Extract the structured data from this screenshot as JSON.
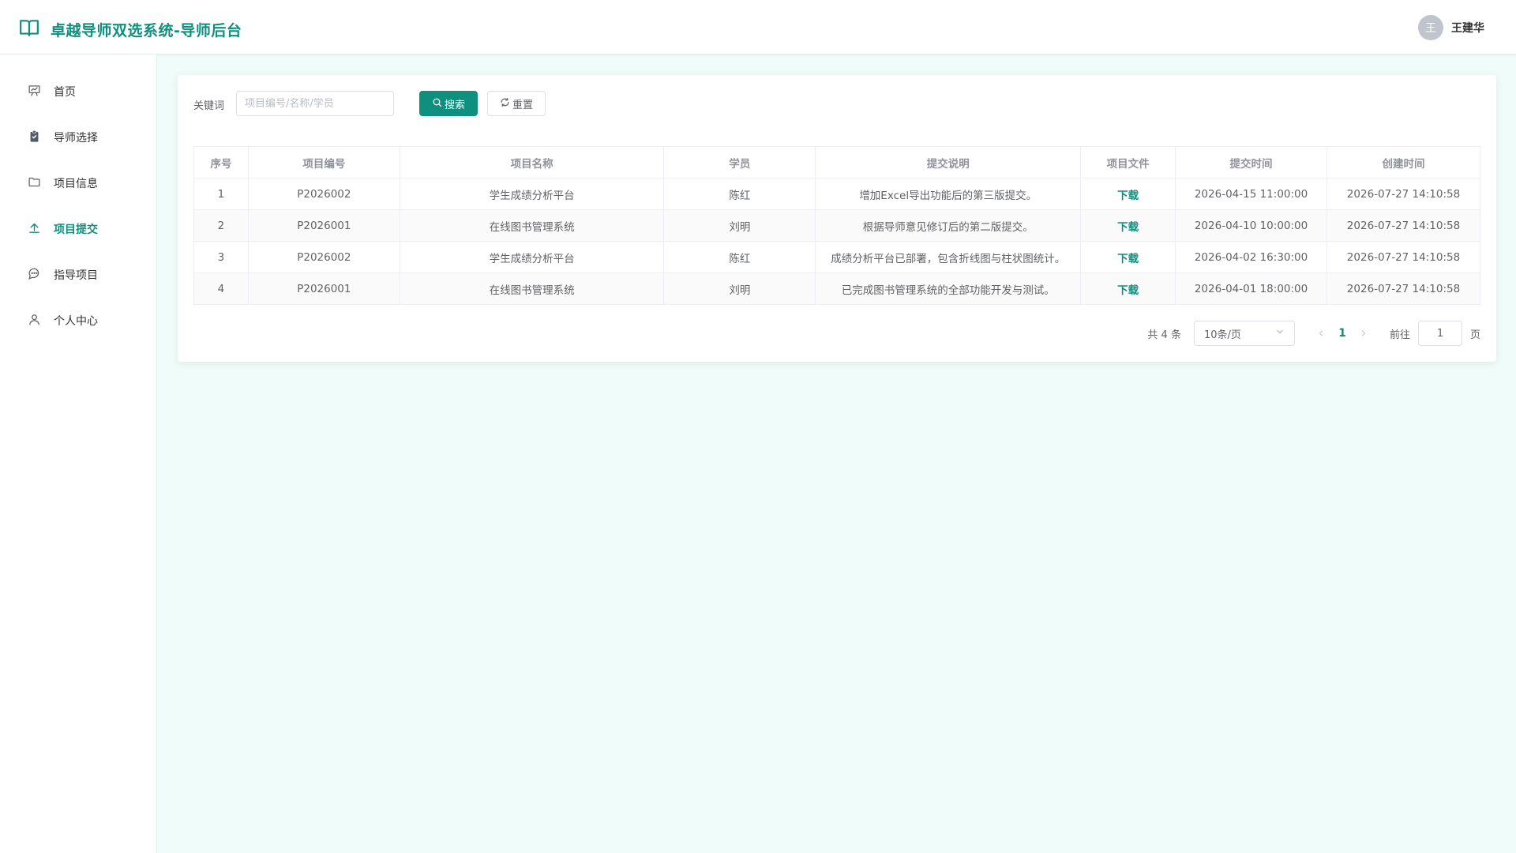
{
  "app": {
    "title": "卓越导师双选系统-导师后台",
    "user_avatar_char": "王",
    "user_name": "王建华",
    "accent_color": "#0f8f7e"
  },
  "sidebar": {
    "items": [
      {
        "label": "首页",
        "icon": "presentation-icon",
        "active": false
      },
      {
        "label": "导师选择",
        "icon": "clipboard-check-icon",
        "active": false
      },
      {
        "label": "项目信息",
        "icon": "folder-icon",
        "active": false
      },
      {
        "label": "项目提交",
        "icon": "upload-icon",
        "active": true
      },
      {
        "label": "指导项目",
        "icon": "chat-bubble-icon",
        "active": false
      },
      {
        "label": "个人中心",
        "icon": "user-icon",
        "active": false
      }
    ]
  },
  "search": {
    "label": "关键词",
    "placeholder": "项目编号/名称/学员",
    "value": "",
    "search_label": "搜索",
    "reset_label": "重置"
  },
  "table": {
    "columns": [
      "序号",
      "项目编号",
      "项目名称",
      "学员",
      "提交说明",
      "项目文件",
      "提交时间",
      "创建时间"
    ],
    "rows": [
      {
        "index": "1",
        "code": "P2026002",
        "name": "学生成绩分析平台",
        "student": "陈红",
        "note": "增加Excel导出功能后的第三版提交。",
        "file": "下载",
        "submit_time": "2026-04-15 11:00:00",
        "create_time": "2026-07-27 14:10:58"
      },
      {
        "index": "2",
        "code": "P2026001",
        "name": "在线图书管理系统",
        "student": "刘明",
        "note": "根据导师意见修订后的第二版提交。",
        "file": "下载",
        "submit_time": "2026-04-10 10:00:00",
        "create_time": "2026-07-27 14:10:58"
      },
      {
        "index": "3",
        "code": "P2026002",
        "name": "学生成绩分析平台",
        "student": "陈红",
        "note": "成绩分析平台已部署，包含折线图与柱状图统计。",
        "file": "下载",
        "submit_time": "2026-04-02 16:30:00",
        "create_time": "2026-07-27 14:10:58"
      },
      {
        "index": "4",
        "code": "P2026001",
        "name": "在线图书管理系统",
        "student": "刘明",
        "note": "已完成图书管理系统的全部功能开发与测试。",
        "file": "下载",
        "submit_time": "2026-04-01 18:00:00",
        "create_time": "2026-07-27 14:10:58"
      }
    ]
  },
  "pagination": {
    "total_text": "共 4 条",
    "page_size": "10条/页",
    "current_page": "1",
    "goto_label": "前往",
    "goto_value": "1",
    "page_unit": "页"
  }
}
